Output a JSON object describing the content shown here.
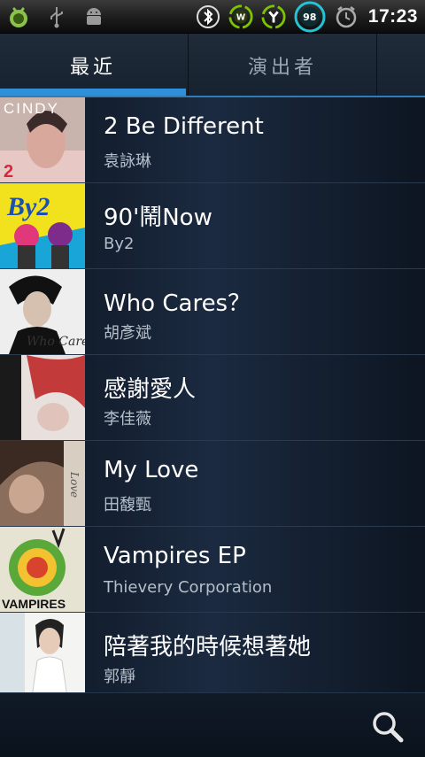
{
  "statusbar": {
    "time": "17:23",
    "battery": "98",
    "left_icons": [
      "app-icon",
      "usb-icon",
      "android-debug-icon"
    ],
    "right_icons": [
      "bluetooth-icon",
      "wifi-w-icon",
      "signal-y-icon",
      "battery-icon",
      "alarm-icon"
    ]
  },
  "tabs": [
    {
      "label": "最近",
      "active": true
    },
    {
      "label": "演出者",
      "active": false
    }
  ],
  "albums": [
    {
      "title": "2 Be Different",
      "artist": "袁詠琳",
      "cover_text": "CINDY"
    },
    {
      "title": "90'鬧Now",
      "artist": "By2",
      "cover_text": "By2"
    },
    {
      "title": "Who Cares？",
      "artist": "胡彥斌",
      "cover_text": "Who Cares"
    },
    {
      "title": "感謝愛人",
      "artist": "李佳薇",
      "cover_text": ""
    },
    {
      "title": "My Love",
      "artist": "田馥甄",
      "cover_text": "Love"
    },
    {
      "title": "Vampires EP",
      "artist": "Thievery Corporation",
      "cover_text": "VAMPIRES"
    },
    {
      "title": "陪著我的時候想著她",
      "artist": "郭靜",
      "cover_text": ""
    }
  ],
  "colors": {
    "accent": "#2f8fd8",
    "list_bg": "#1b2a40"
  },
  "bottombar": {
    "action_icon": "search-icon"
  }
}
